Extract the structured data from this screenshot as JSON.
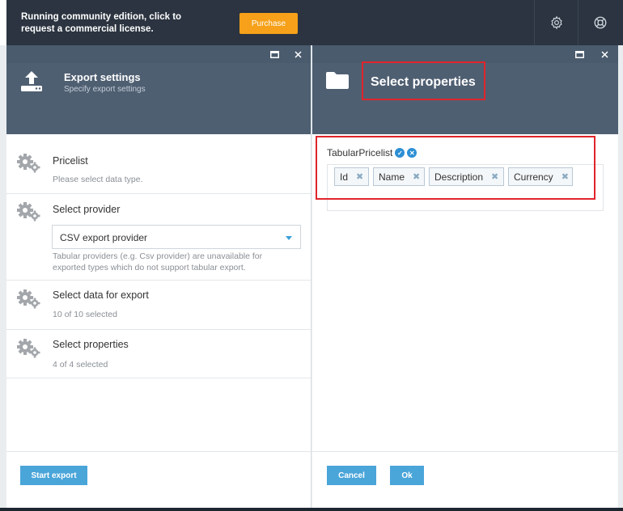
{
  "topbar": {
    "notice": "Running community edition, click to request a commercial license.",
    "purchase_label": "Purchase"
  },
  "export_blade": {
    "title": "Export settings",
    "subtitle": "Specify export settings",
    "items": [
      {
        "title": "Pricelist",
        "sub": "Please select data type."
      },
      {
        "title": "Select provider",
        "selected_provider": "CSV export provider",
        "hint": "Tabular providers (e.g. Csv provider) are unavailable for exported types which do not support tabular export."
      },
      {
        "title": "Select data for export",
        "sub": "10 of 10 selected"
      },
      {
        "title": "Select properties",
        "sub": "4 of 4 selected"
      }
    ],
    "start_label": "Start export"
  },
  "props_blade": {
    "title": "Select properties",
    "group_label": "TabularPricelist",
    "tags": [
      "Id",
      "Name",
      "Description",
      "Currency"
    ],
    "cancel_label": "Cancel",
    "ok_label": "Ok"
  },
  "colors": {
    "accent": "#4aa5d9",
    "purchase": "#f6a119",
    "header": "#4f5f72",
    "highlight": "#e0242b"
  }
}
